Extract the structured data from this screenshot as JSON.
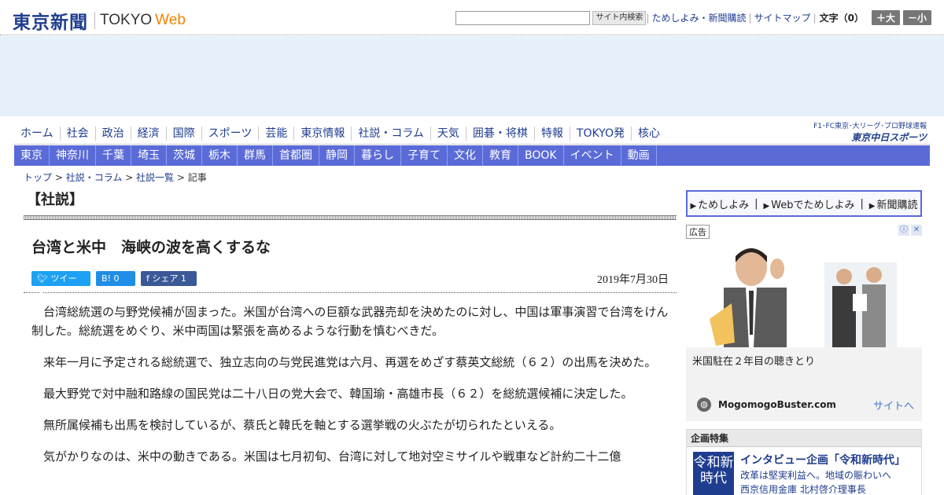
{
  "header": {
    "logo_jp": "東京新聞",
    "logo_en": "TOKYO",
    "logo_web": "Web",
    "search_button": "サイト内検索",
    "search_placeholder": "",
    "links": [
      "ためしよみ・新聞購読",
      "サイトマップ"
    ],
    "font_size_label": "文字（0）",
    "font_bigger": "＋大",
    "font_smaller": "－小"
  },
  "nav_primary": [
    "ホーム",
    "社会",
    "政治",
    "経済",
    "国際",
    "スポーツ",
    "芸能",
    "東京情報",
    "社説・コラム",
    "天気",
    "囲碁・将棋",
    "特報",
    "TOKYO発",
    "核心"
  ],
  "sports_banner": {
    "top": "F1･FC東京･大リーグ･プロ野球速報",
    "logo": "東京中日スポーツ"
  },
  "nav_regional": [
    "東京",
    "神奈川",
    "千葉",
    "埼玉",
    "茨城",
    "栃木",
    "群馬",
    "首都圏",
    "静岡",
    "暮らし",
    "子育て",
    "文化",
    "教育",
    "BOOK",
    "イベント",
    "動画"
  ],
  "breadcrumb": {
    "items": [
      "トップ",
      "社説・コラム",
      "社説一覧"
    ],
    "current": "記事",
    "sep": " > "
  },
  "article": {
    "section": "【社説】",
    "title": "台湾と米中　海峡の波を高くするな",
    "date": "2019年7月30日",
    "share": {
      "tweet": "ツイート",
      "hatena_count": "B! 0",
      "facebook": "シェア 1"
    },
    "paragraphs": [
      "台湾総統選の与野党候補が固まった。米国が台湾への巨額な武器売却を決めたのに対し、中国は軍事演習で台湾をけん制した。総統選をめぐり、米中両国は緊張を高めるような行動を慎むべきだ。",
      "来年一月に予定される総統選で、独立志向の与党民進党は六月、再選をめざす蔡英文総統（６２）の出馬を決めた。",
      "最大野党で対中融和路線の国民党は二十八日の党大会で、韓国瑜・高雄市長（６２）を総統選候補に決定した。",
      "無所属候補も出馬を検討しているが、蔡氏と韓氏を軸とする選挙戦の火ぶたが切られたといえる。",
      "気がかりなのは、米中の動きである。米国は七月初旬、台湾に対して地対空ミサイルや戦車など計約二十二億"
    ]
  },
  "sidebar": {
    "subscribe": [
      "ためしよみ",
      "Webでためしよみ",
      "新聞購読"
    ],
    "ad_label": "広告",
    "ad_title": "米国駐在２年目の聴きとり",
    "ad_site": "MogomogoBuster.com",
    "ad_link": "サイトへ",
    "feature_header": "企画特集",
    "feature_badge": "令和新時代",
    "feature_title": "インタビュー企画「令和新時代」",
    "feature_desc_1": "改革は堅実利益へ。地域の賑わいへ",
    "feature_desc_2": "西京信用金庫 北村啓介理事長"
  },
  "colors": {
    "brand": "#1f3d8f",
    "nav_regional_bg": "#5a6bd8",
    "ad_band_bg": "#e6f0fb",
    "accent_orange": "#f08300"
  }
}
